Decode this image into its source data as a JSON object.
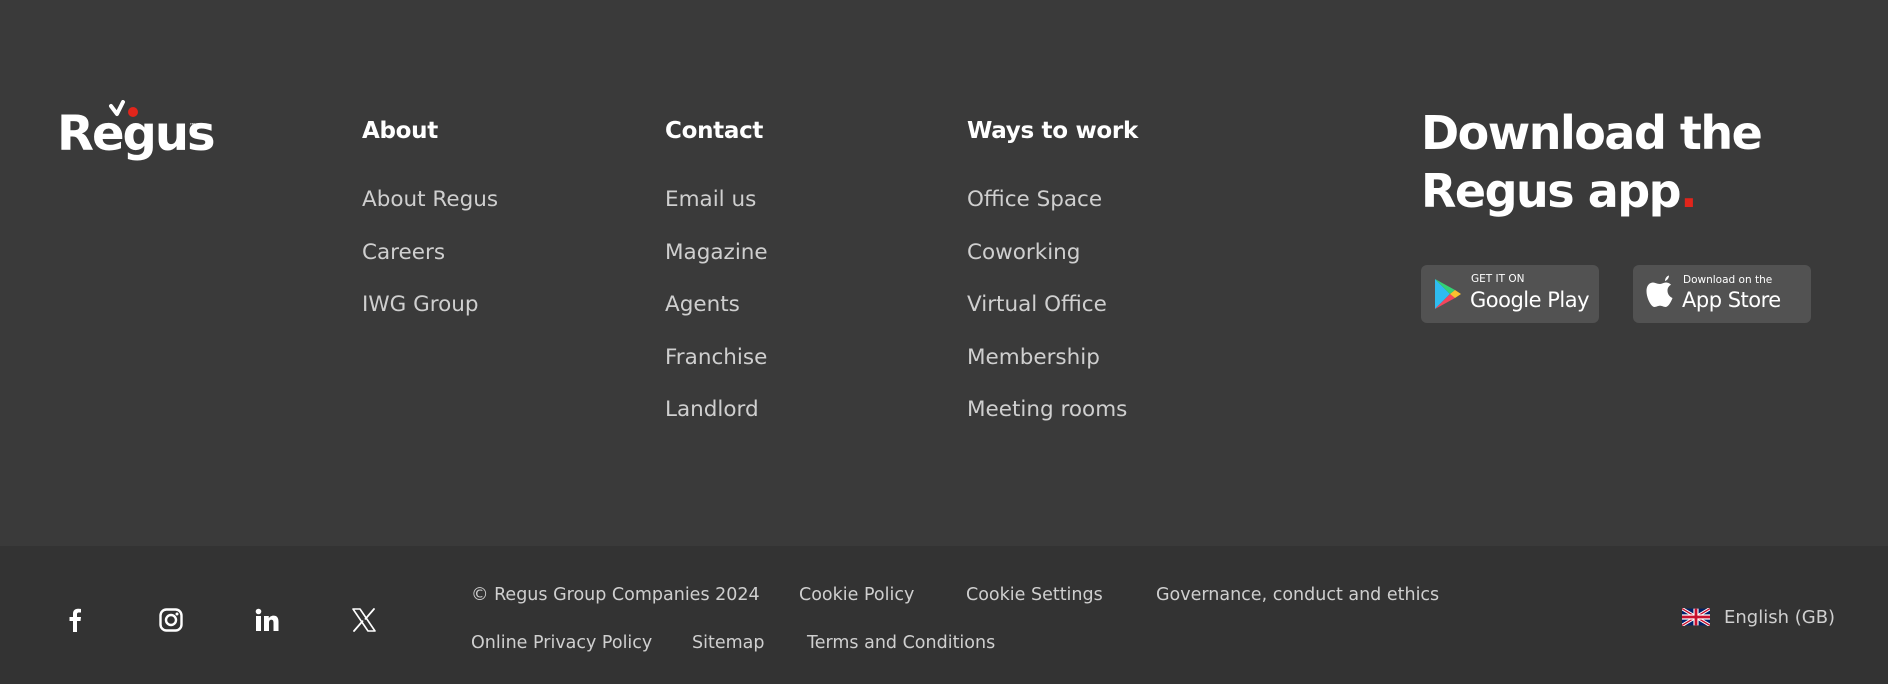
{
  "brand": {
    "logo_text": "Regus",
    "tm": "™",
    "accent": "#e1251b"
  },
  "columns": {
    "about": {
      "title": "About",
      "items": [
        "About Regus",
        "Careers",
        "IWG Group"
      ]
    },
    "contact": {
      "title": "Contact",
      "items": [
        "Email us",
        "Magazine",
        "Agents",
        "Franchise",
        "Landlord"
      ]
    },
    "ways": {
      "title": "Ways to work",
      "items": [
        "Office Space",
        "Coworking",
        "Virtual Office",
        "Membership",
        "Meeting rooms"
      ]
    }
  },
  "app": {
    "title_line1": "Download the",
    "title_line2": "Regus app",
    "title_dot": ".",
    "google_play": {
      "small": "GET IT ON",
      "big": "Google Play"
    },
    "app_store": {
      "small": "Download on the",
      "big": "App Store"
    }
  },
  "social": {
    "icons": [
      "facebook-icon",
      "instagram-icon",
      "linkedin-icon",
      "x-icon"
    ]
  },
  "legal": {
    "copyright": "© Regus Group Companies 2024",
    "cookie_policy": "Cookie Policy",
    "cookie_settings": "Cookie Settings",
    "governance": "Governance, conduct and ethics",
    "privacy": "Online Privacy Policy",
    "sitemap": "Sitemap",
    "terms": "Terms and Conditions"
  },
  "language": {
    "label": "English (GB)",
    "flag": "uk-flag-icon"
  },
  "colors": {
    "background": "#3a3a3a",
    "bottom_bar": "#333333",
    "link_text": "#cfcfcf",
    "store_button": "#525252"
  }
}
